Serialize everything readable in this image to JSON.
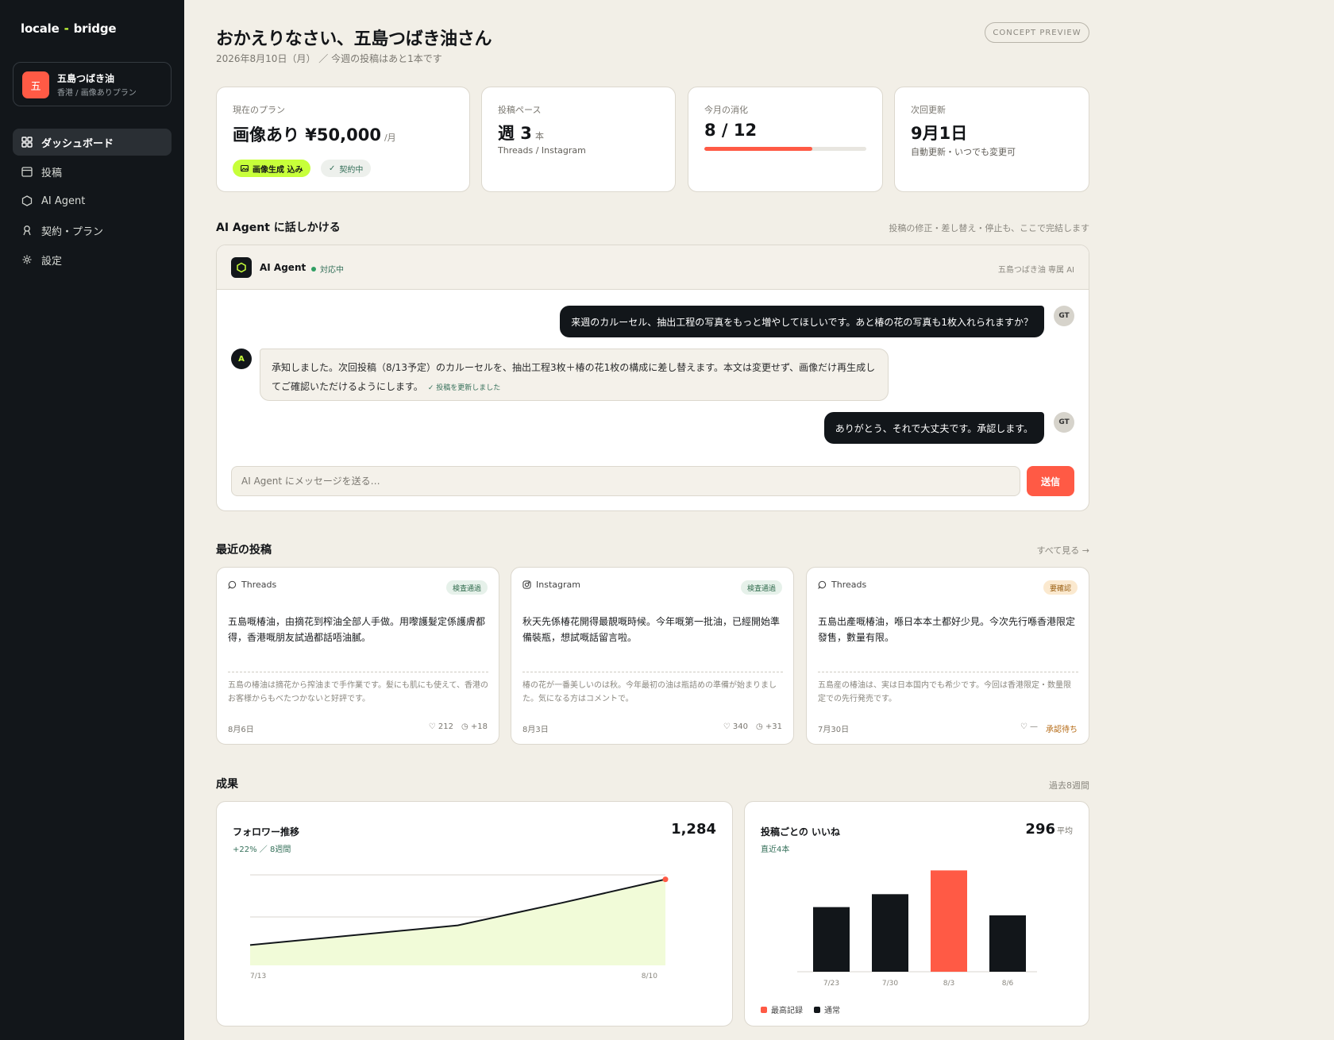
{
  "app": {
    "logo_left": "locale",
    "logo_sep": "-",
    "logo_right": "bridge"
  },
  "account": {
    "avatar": "五",
    "name": "五島つばき油",
    "plan": "香港 / 画像ありプラン"
  },
  "nav": [
    {
      "label": "ダッシュボード",
      "icon": "dashboard-grid-icon",
      "active": true
    },
    {
      "label": "投稿",
      "icon": "calendar-icon",
      "active": false
    },
    {
      "label": "AI Agent",
      "icon": "hexagon-icon",
      "active": false
    },
    {
      "label": "契約・プラン",
      "icon": "contract-icon",
      "active": false
    },
    {
      "label": "設定",
      "icon": "gear-icon",
      "active": false
    }
  ],
  "header": {
    "greeting": "おかえりなさい、五島つばき油さん",
    "date_line": "2026年8月10日（月） ／ 今週の投稿はあと1本です",
    "preview_pill": "CONCEPT PREVIEW"
  },
  "kpis": {
    "plan": {
      "label": "現在のプラン",
      "value": "画像あり ¥50,000",
      "unit": "/月",
      "badge_image": "画像生成 込み",
      "badge_status": "契約中"
    },
    "pace": {
      "label": "投稿ペース",
      "value": "週 3",
      "unit": "本",
      "sub": "Threads / Instagram"
    },
    "usage": {
      "label": "今月の消化",
      "value": "8 / 12",
      "used": 8,
      "total": 12
    },
    "renewal": {
      "label": "次回更新",
      "value": "9月1日",
      "sub": "自動更新・いつでも変更可"
    }
  },
  "agent_section": {
    "title": "AI Agent に話しかける",
    "note": "投稿の修正・差し替え・停止も、ここで完結します"
  },
  "chat": {
    "agent_name": "AI Agent",
    "status": "対応中",
    "meta": "五島つばき油 専属 AI",
    "messages": [
      {
        "from": "user",
        "avatar": "GT",
        "text": "来週のカルーセル、抽出工程の写真をもっと増やしてほしいです。あと椿の花の写真も1枚入れられますか？"
      },
      {
        "from": "agent",
        "avatar": "A",
        "text": "承知しました。次回投稿（8/13予定）のカルーセルを、抽出工程3枚＋椿の花1枚の構成に差し替えます。本文は変更せず、画像だけ再生成してご確認いただけるようにします。",
        "status": "投稿を更新しました"
      },
      {
        "from": "user",
        "avatar": "GT",
        "text": "ありがとう、それで大丈夫です。承認します。"
      }
    ],
    "input_placeholder": "AI Agent にメッセージを送る…",
    "send_label": "送信"
  },
  "posts_section": {
    "title": "最近の投稿",
    "see_all": "すべて見る →"
  },
  "posts": [
    {
      "platform": "Threads",
      "platform_icon": "chat-bubble-icon",
      "badge": "検査通過",
      "badge_kind": "pass",
      "text": "五島嘅椿油，由摘花到榨油全部人手做。用嚟護髮定係護膚都得，香港嘅朋友試過都話唔油膩。",
      "translation": "五島の椿油は摘花から搾油まで手作業です。髪にも肌にも使えて、香港のお客様からもべたつかないと好評です。",
      "date": "8月6日",
      "likes": "212",
      "delta": "+18"
    },
    {
      "platform": "Instagram",
      "platform_icon": "instagram-icon",
      "badge": "検査通過",
      "badge_kind": "pass",
      "text": "秋天先係椿花開得最靚嘅時候。今年嘅第一批油，已經開始準備裝瓶，想試嘅話留言啦。",
      "translation": "椿の花が一番美しいのは秋。今年最初の油は瓶詰めの準備が始まりました。気になる方はコメントで。",
      "date": "8月3日",
      "likes": "340",
      "delta": "+31"
    },
    {
      "platform": "Threads",
      "platform_icon": "chat-bubble-icon",
      "badge": "要確認",
      "badge_kind": "check",
      "text": "五島出產嘅椿油，喺日本本土都好少見。今次先行喺香港限定發售，數量有限。",
      "translation": "五島産の椿油は、実は日本国内でも希少です。今回は香港限定・数量限定での先行発売です。",
      "date": "7月30日",
      "likes": "—",
      "status": "承認待ち"
    }
  ],
  "results_section": {
    "title": "成果",
    "note": "過去8週間"
  },
  "chart_data": [
    {
      "type": "area",
      "title": "フォロワー推移",
      "subtitle": "+22% ／ 8週間",
      "headline": "1,284",
      "x": [
        "7/13",
        "7/20",
        "7/27",
        "8/3",
        "8/10"
      ],
      "x_tick_labels": [
        "7/13",
        "8/10"
      ],
      "values": [
        1050,
        1085,
        1120,
        1200,
        1284
      ],
      "ylim": [
        1000,
        1300
      ],
      "grid": true,
      "colors": {
        "line": "#12161a",
        "fill": "#f1fbd8",
        "endpoint": "#ff5a45"
      }
    },
    {
      "type": "bar",
      "title": "投稿ごとの いいね",
      "subtitle": "直近4本",
      "headline": "296",
      "headline_unit": "平均",
      "categories": [
        "7/23",
        "7/30",
        "8/3",
        "8/6"
      ],
      "values": [
        250,
        300,
        392,
        218
      ],
      "highlight_index": 2,
      "ylim": [
        0,
        430
      ],
      "legend": [
        {
          "label": "最高記録",
          "color": "#ff5a45"
        },
        {
          "label": "通常",
          "color": "#12161a"
        }
      ]
    }
  ]
}
